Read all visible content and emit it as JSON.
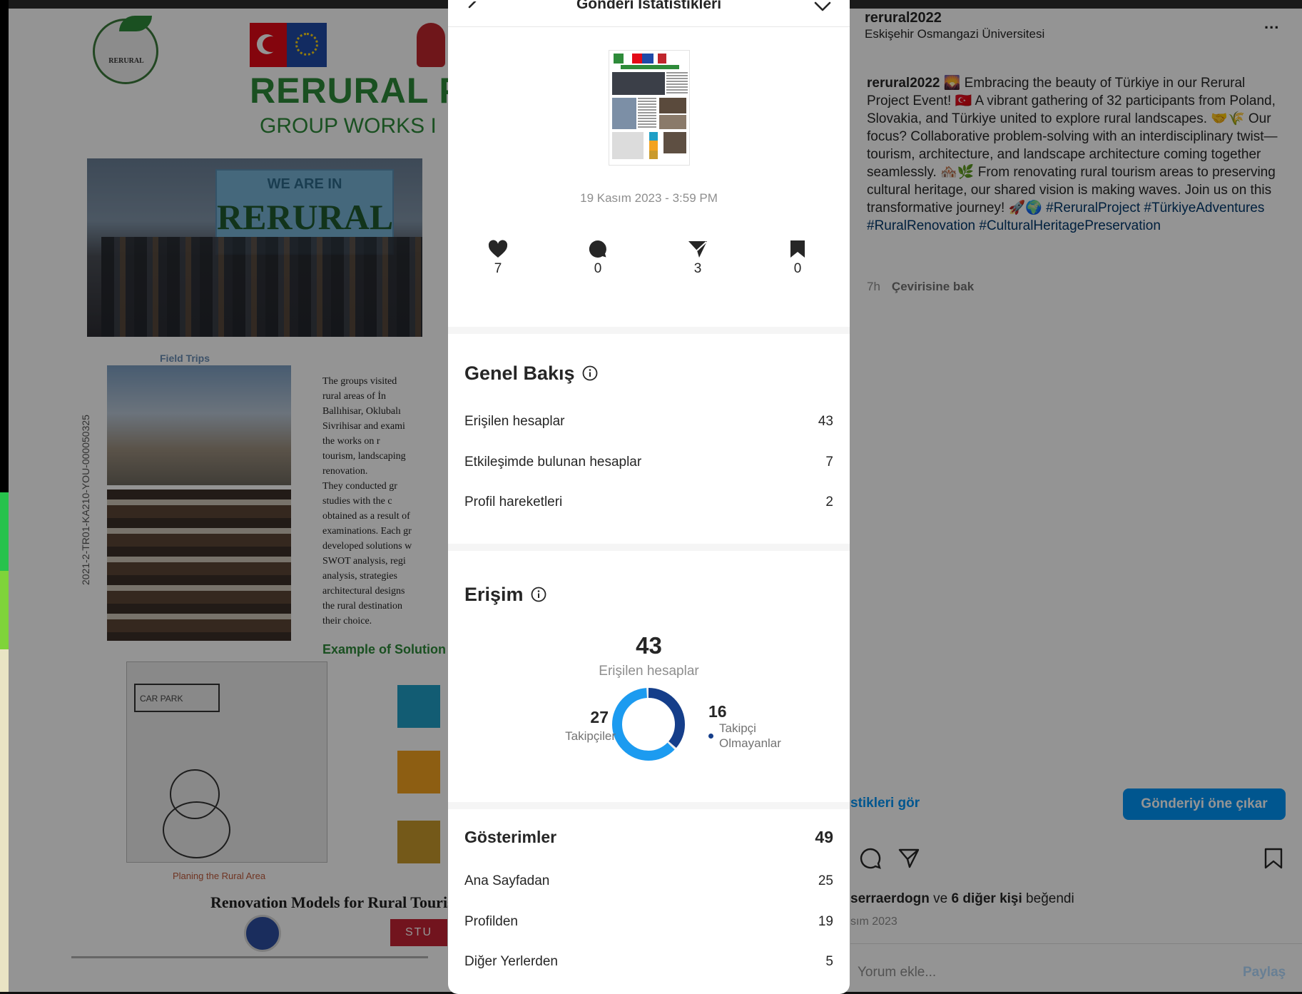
{
  "poster": {
    "logo_text": "RERURAL",
    "title": "RERURAL PI",
    "subtitle": "GROUP WORKS I",
    "banner_line1": "WE ARE IN",
    "banner_line2": "RERURAL",
    "project_code": "2021-2-TR01-KA210-YOU-000050325",
    "field_trips": "Field Trips",
    "body_text": "The groups visited\nrural areas of İn\nBallıhisar, Oklubalı\nSivrihisar and exami\nthe works on r\ntourism, landscaping\nrenovation.\nThey conducted gr\nstudies with the c\nobtained as a result of\nexaminations. Each gr\ndeveloped solutions w\nSWOT analysis, regi\nanalysis, strategies\narchitectural designs\nthe rural destination\ntheir choice.",
    "example": "Example of Solution",
    "sketch_label": "CAR PARK",
    "planning": "Planing the Rural Area",
    "renovation": "Renovation Models for Rural Touris",
    "stu": "STU"
  },
  "post": {
    "username": "rerural2022",
    "location": "Eskişehir Osmangazi Üniversitesi",
    "more": "...",
    "caption_user": "rerural2022",
    "caption_text": " 🌄 Embracing the beauty of Türkiye in our Rerural Project Event! 🇹🇷 A vibrant gathering of 32 participants from Poland, Slovakia, and Türkiye united to explore rural landscapes. 🤝🌾 Our focus? Collaborative problem-solving with an interdisciplinary twist—tourism, architecture, and landscape architecture coming together seamlessly. 🏘️🌿 From renovating rural tourism areas to preserving cultural heritage, our shared vision is making waves. Join us on this transformative journey! 🚀🌍 ",
    "caption_tags": "#ReruralProject #TürkiyeAdventures #RuralRenovation #CulturalHeritagePreservation",
    "time_ago": "7h",
    "see_translation": "Çevirisine bak",
    "insights_link": "stikleri gör",
    "boost_button": "Gönderiyi öne çıkar",
    "likes_user": "serraerdogn",
    "likes_rest_1": " ve ",
    "likes_others": "6 diğer kişi",
    "likes_rest_2": " beğendi",
    "date_short": "sım 2023",
    "comment_placeholder": "Yorum ekle...",
    "share_label": "Paylaş"
  },
  "modal": {
    "title": "Gönderi İstatistikleri",
    "post_date": "19 Kasım 2023 - 3:59 PM",
    "stats": {
      "likes": "7",
      "comments": "0",
      "shares": "3",
      "saves": "0"
    },
    "overview": {
      "title": "Genel Bakış",
      "rows": [
        {
          "label": "Erişilen hesaplar",
          "value": "43"
        },
        {
          "label": "Etkileşimde bulunan hesaplar",
          "value": "7"
        },
        {
          "label": "Profil hareketleri",
          "value": "2"
        }
      ]
    },
    "reach": {
      "title": "Erişim",
      "total": "43",
      "total_label": "Erişilen hesaplar",
      "followers_value": "27",
      "followers_label": "Takipçiler",
      "non_followers_value": "16",
      "non_followers_label": "Takipçi Olmayanlar",
      "followers_color": "#1c9bf0",
      "non_followers_color": "#153e8a"
    },
    "impressions": {
      "title": "Gösterimler",
      "total": "49",
      "rows": [
        {
          "label": "Ana Sayfadan",
          "value": "25"
        },
        {
          "label": "Profilden",
          "value": "19"
        },
        {
          "label": "Diğer Yerlerden",
          "value": "5"
        }
      ]
    }
  }
}
